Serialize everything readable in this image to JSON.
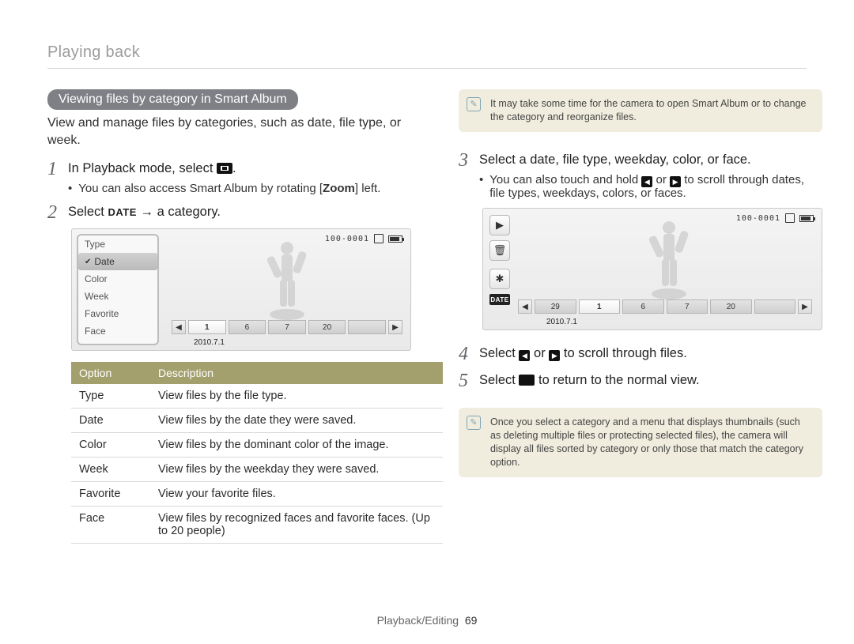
{
  "breadcrumb": "Playing back",
  "pill": "Viewing files by category in Smart Album",
  "intro": "View and manage files by categories, such as date, file type, or week.",
  "steps": {
    "s1": {
      "num": "1",
      "text_before": "In Playback mode, select ",
      "text_after": "."
    },
    "s1sub": "You can also access Smart Album by rotating [Zoom] left.",
    "s2": {
      "num": "2",
      "text_a": "Select ",
      "date_word": "DATE",
      "arrow": " → ",
      "text_b": "a category."
    },
    "s3": {
      "num": "3",
      "text": "Select a date, file type, weekday, color, or face."
    },
    "s3sub": "You can also touch and hold ◀ or ▶ to scroll through dates, file types, weekdays, colors, or faces.",
    "s4": {
      "num": "4",
      "text_a": "Select ",
      "text_mid": " or ",
      "text_b": " to scroll through files."
    },
    "s5": {
      "num": "5",
      "text_a": "Select ",
      "text_b": " to return to the normal view."
    }
  },
  "menu": {
    "items": [
      "Type",
      "Date",
      "Color",
      "Week",
      "Favorite",
      "Face"
    ],
    "selected": "Date"
  },
  "scr1": {
    "counter": "100-0001",
    "timeline": [
      "1",
      "6",
      "7",
      "20"
    ],
    "date": "2010.7.1"
  },
  "scr2": {
    "counter": "100-0001",
    "icons": {
      "play": "▶",
      "trash": "🗑",
      "menu": "✱",
      "date": "DATE"
    },
    "timeline": [
      "29",
      "1",
      "6",
      "7",
      "20"
    ],
    "date": "2010.7.1"
  },
  "table": {
    "head": {
      "option": "Option",
      "desc": "Description"
    },
    "rows": [
      {
        "option": "Type",
        "desc": "View files by the file type."
      },
      {
        "option": "Date",
        "desc": "View files by the date they were saved."
      },
      {
        "option": "Color",
        "desc": "View files by the dominant color of the image."
      },
      {
        "option": "Week",
        "desc": "View files by the weekday they were saved."
      },
      {
        "option": "Favorite",
        "desc": "View your favorite files."
      },
      {
        "option": "Face",
        "desc": "View files by recognized faces and favorite faces. (Up to 20 people)"
      }
    ]
  },
  "note1": "It may take some time for the camera to open Smart Album or to change the category and reorganize files.",
  "note2": "Once you select a category and a menu that displays thumbnails (such as deleting multiple files or protecting selected files), the camera will display all files sorted by category or only those that match the category option.",
  "footer": {
    "section": "Playback/Editing",
    "page": "69"
  }
}
